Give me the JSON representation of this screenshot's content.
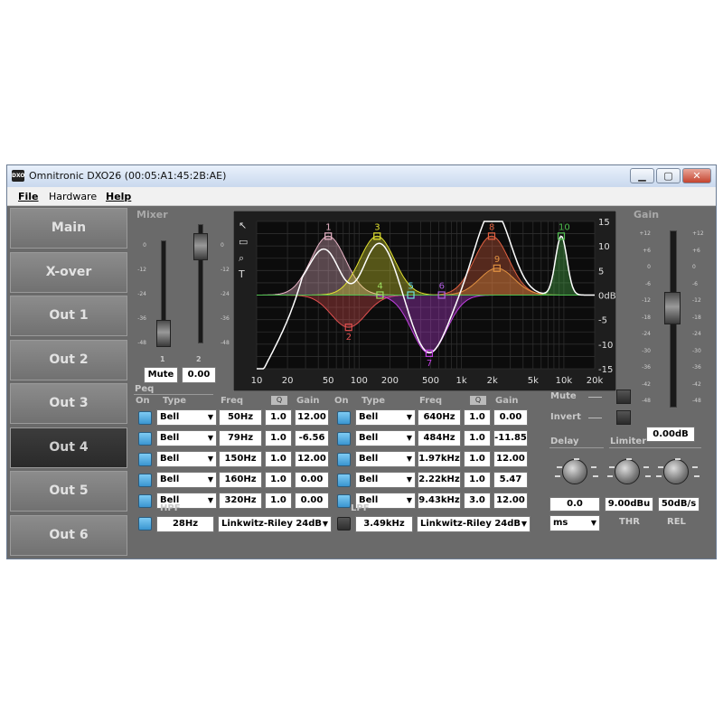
{
  "window": {
    "title": "Omnitronic DXO26 (00:05:A1:45:2B:AE)",
    "icon_text": "DXO",
    "controls": [
      "minimize-icon",
      "maximize-icon",
      "close-icon"
    ]
  },
  "menu": {
    "file": "File",
    "hardware": "Hardware",
    "help": "Help"
  },
  "nav": {
    "items": [
      "Main",
      "X-over",
      "Out 1",
      "Out 2",
      "Out 3",
      "Out 4",
      "Out 5",
      "Out 6"
    ],
    "active": "Out 4"
  },
  "mixer": {
    "label": "Mixer",
    "scale": [
      "0",
      "-12",
      "-24",
      "-36",
      "-48"
    ],
    "fader1_label": "1",
    "fader2_label": "2",
    "fader1_level": 0.12,
    "fader2_level": 0.92,
    "mute_label": "Mute",
    "value": "0.00"
  },
  "graph": {
    "x_ticks": [
      "10",
      "20",
      "50",
      "100",
      "200",
      "500",
      "1k",
      "2k",
      "5k",
      "10k",
      "20k"
    ],
    "y_ticks": [
      "15",
      "10",
      "5",
      "0dB",
      "-5",
      "-10",
      "-15"
    ],
    "band_labels": [
      "1",
      "2",
      "3",
      "4",
      "5",
      "6",
      "7",
      "8",
      "9",
      "10"
    ],
    "tool_icons": [
      "pointer-icon",
      "camera-icon",
      "zoom-icon",
      "text-icon"
    ]
  },
  "gain": {
    "label": "Gain",
    "scale": [
      "+12",
      "+6",
      "0",
      "-6",
      "-12",
      "-18",
      "-24",
      "-30",
      "-36",
      "-42",
      "-48"
    ],
    "level": 0.62,
    "value": "0.00dB"
  },
  "peq": {
    "label": "Peq",
    "headers": {
      "on": "On",
      "type": "Type",
      "freq": "Freq",
      "q": "Q",
      "gain": "Gain"
    },
    "left": [
      {
        "type": "Bell",
        "freq": "50Hz",
        "q": "1.0",
        "gain": "12.00"
      },
      {
        "type": "Bell",
        "freq": "79Hz",
        "q": "1.0",
        "gain": "-6.56"
      },
      {
        "type": "Bell",
        "freq": "150Hz",
        "q": "1.0",
        "gain": "12.00"
      },
      {
        "type": "Bell",
        "freq": "160Hz",
        "q": "1.0",
        "gain": "0.00"
      },
      {
        "type": "Bell",
        "freq": "320Hz",
        "q": "1.0",
        "gain": "0.00"
      }
    ],
    "right": [
      {
        "type": "Bell",
        "freq": "640Hz",
        "q": "1.0",
        "gain": "0.00"
      },
      {
        "type": "Bell",
        "freq": "484Hz",
        "q": "1.0",
        "gain": "-11.85"
      },
      {
        "type": "Bell",
        "freq": "1.97kHz",
        "q": "1.0",
        "gain": "12.00"
      },
      {
        "type": "Bell",
        "freq": "2.22kHz",
        "q": "1.0",
        "gain": "5.47"
      },
      {
        "type": "Bell",
        "freq": "9.43kHz",
        "q": "3.0",
        "gain": "12.00"
      }
    ]
  },
  "hpf": {
    "label": "HPF",
    "freq": "28Hz",
    "type": "Linkwitz-Riley 24dB"
  },
  "lpf": {
    "label": "LPF",
    "freq": "3.49kHz",
    "type": "Linkwitz-Riley 24dB"
  },
  "side": {
    "mute_label": "Mute",
    "invert_label": "Invert",
    "delay_label": "Delay",
    "limiter_label": "Limiter",
    "delay_value": "0.0",
    "delay_unit": "ms",
    "thr_value": "9.00dBu",
    "rel_value": "50dB/s",
    "thr_label": "THR",
    "rel_label": "REL"
  },
  "colors": {
    "accent": "#3a95d0",
    "panel": "#6a6a6a",
    "graph_bg": "#0c0c0c"
  }
}
